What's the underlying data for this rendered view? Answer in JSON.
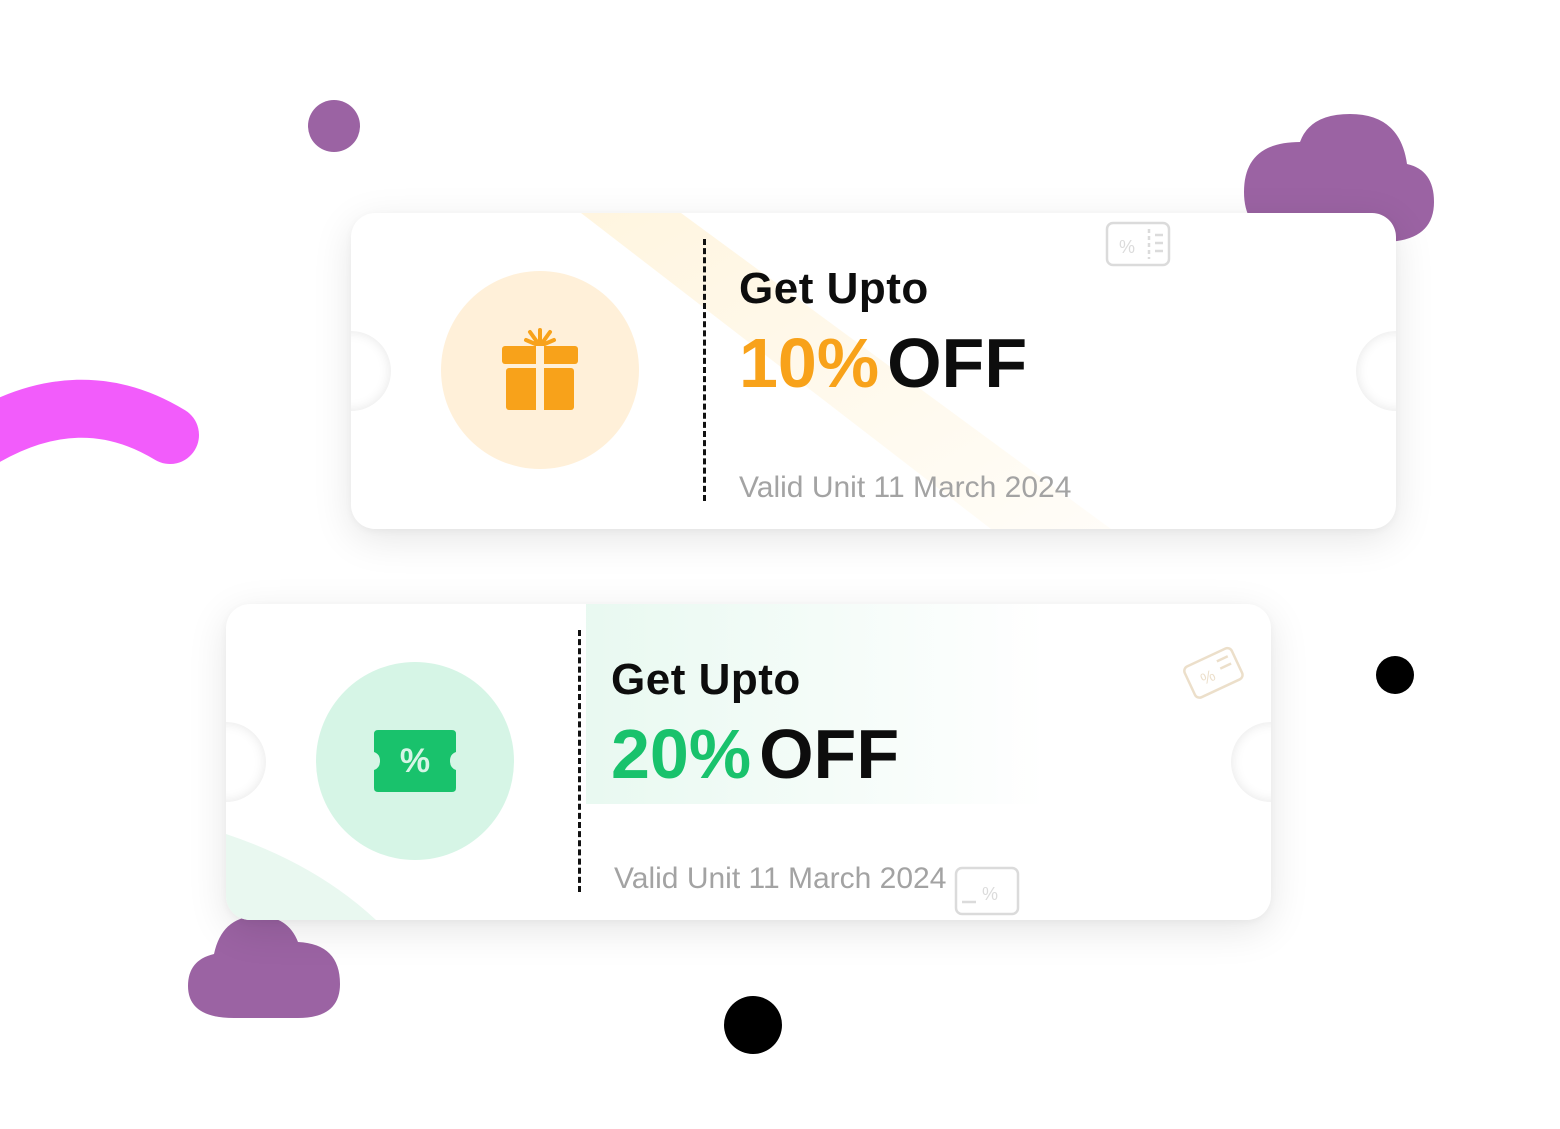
{
  "coupons": [
    {
      "headline": "Get Upto",
      "percent": "10%",
      "off": "OFF",
      "valid": "Valid Unit 11 March 2024",
      "icon": "gift-icon",
      "accent": "#f8a21a",
      "icon_bg": "#fff0d9"
    },
    {
      "headline": "Get Upto",
      "percent": "20%",
      "off": "OFF",
      "valid": "Valid Unit 11 March 2024",
      "icon": "discount-ticket-icon",
      "accent": "#19c26c",
      "icon_bg": "#d6f5e6"
    }
  ],
  "decor_colors": {
    "purple": "#9b63a3",
    "magenta": "#f25cfb",
    "black": "#000000"
  }
}
